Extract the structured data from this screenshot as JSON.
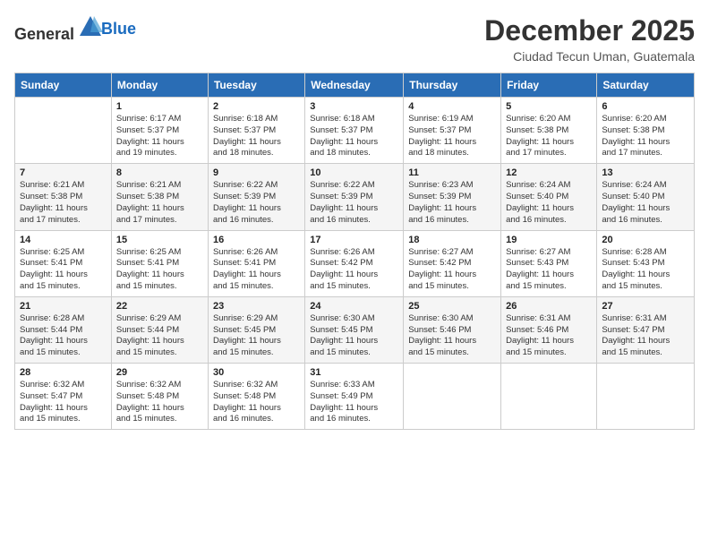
{
  "header": {
    "logo_general": "General",
    "logo_blue": "Blue",
    "title": "December 2025",
    "subtitle": "Ciudad Tecun Uman, Guatemala"
  },
  "weekdays": [
    "Sunday",
    "Monday",
    "Tuesday",
    "Wednesday",
    "Thursday",
    "Friday",
    "Saturday"
  ],
  "weeks": [
    [
      {
        "day": "",
        "info": ""
      },
      {
        "day": "1",
        "info": "Sunrise: 6:17 AM\nSunset: 5:37 PM\nDaylight: 11 hours\nand 19 minutes."
      },
      {
        "day": "2",
        "info": "Sunrise: 6:18 AM\nSunset: 5:37 PM\nDaylight: 11 hours\nand 18 minutes."
      },
      {
        "day": "3",
        "info": "Sunrise: 6:18 AM\nSunset: 5:37 PM\nDaylight: 11 hours\nand 18 minutes."
      },
      {
        "day": "4",
        "info": "Sunrise: 6:19 AM\nSunset: 5:37 PM\nDaylight: 11 hours\nand 18 minutes."
      },
      {
        "day": "5",
        "info": "Sunrise: 6:20 AM\nSunset: 5:38 PM\nDaylight: 11 hours\nand 17 minutes."
      },
      {
        "day": "6",
        "info": "Sunrise: 6:20 AM\nSunset: 5:38 PM\nDaylight: 11 hours\nand 17 minutes."
      }
    ],
    [
      {
        "day": "7",
        "info": "Sunrise: 6:21 AM\nSunset: 5:38 PM\nDaylight: 11 hours\nand 17 minutes."
      },
      {
        "day": "8",
        "info": "Sunrise: 6:21 AM\nSunset: 5:38 PM\nDaylight: 11 hours\nand 17 minutes."
      },
      {
        "day": "9",
        "info": "Sunrise: 6:22 AM\nSunset: 5:39 PM\nDaylight: 11 hours\nand 16 minutes."
      },
      {
        "day": "10",
        "info": "Sunrise: 6:22 AM\nSunset: 5:39 PM\nDaylight: 11 hours\nand 16 minutes."
      },
      {
        "day": "11",
        "info": "Sunrise: 6:23 AM\nSunset: 5:39 PM\nDaylight: 11 hours\nand 16 minutes."
      },
      {
        "day": "12",
        "info": "Sunrise: 6:24 AM\nSunset: 5:40 PM\nDaylight: 11 hours\nand 16 minutes."
      },
      {
        "day": "13",
        "info": "Sunrise: 6:24 AM\nSunset: 5:40 PM\nDaylight: 11 hours\nand 16 minutes."
      }
    ],
    [
      {
        "day": "14",
        "info": "Sunrise: 6:25 AM\nSunset: 5:41 PM\nDaylight: 11 hours\nand 15 minutes."
      },
      {
        "day": "15",
        "info": "Sunrise: 6:25 AM\nSunset: 5:41 PM\nDaylight: 11 hours\nand 15 minutes."
      },
      {
        "day": "16",
        "info": "Sunrise: 6:26 AM\nSunset: 5:41 PM\nDaylight: 11 hours\nand 15 minutes."
      },
      {
        "day": "17",
        "info": "Sunrise: 6:26 AM\nSunset: 5:42 PM\nDaylight: 11 hours\nand 15 minutes."
      },
      {
        "day": "18",
        "info": "Sunrise: 6:27 AM\nSunset: 5:42 PM\nDaylight: 11 hours\nand 15 minutes."
      },
      {
        "day": "19",
        "info": "Sunrise: 6:27 AM\nSunset: 5:43 PM\nDaylight: 11 hours\nand 15 minutes."
      },
      {
        "day": "20",
        "info": "Sunrise: 6:28 AM\nSunset: 5:43 PM\nDaylight: 11 hours\nand 15 minutes."
      }
    ],
    [
      {
        "day": "21",
        "info": "Sunrise: 6:28 AM\nSunset: 5:44 PM\nDaylight: 11 hours\nand 15 minutes."
      },
      {
        "day": "22",
        "info": "Sunrise: 6:29 AM\nSunset: 5:44 PM\nDaylight: 11 hours\nand 15 minutes."
      },
      {
        "day": "23",
        "info": "Sunrise: 6:29 AM\nSunset: 5:45 PM\nDaylight: 11 hours\nand 15 minutes."
      },
      {
        "day": "24",
        "info": "Sunrise: 6:30 AM\nSunset: 5:45 PM\nDaylight: 11 hours\nand 15 minutes."
      },
      {
        "day": "25",
        "info": "Sunrise: 6:30 AM\nSunset: 5:46 PM\nDaylight: 11 hours\nand 15 minutes."
      },
      {
        "day": "26",
        "info": "Sunrise: 6:31 AM\nSunset: 5:46 PM\nDaylight: 11 hours\nand 15 minutes."
      },
      {
        "day": "27",
        "info": "Sunrise: 6:31 AM\nSunset: 5:47 PM\nDaylight: 11 hours\nand 15 minutes."
      }
    ],
    [
      {
        "day": "28",
        "info": "Sunrise: 6:32 AM\nSunset: 5:47 PM\nDaylight: 11 hours\nand 15 minutes."
      },
      {
        "day": "29",
        "info": "Sunrise: 6:32 AM\nSunset: 5:48 PM\nDaylight: 11 hours\nand 15 minutes."
      },
      {
        "day": "30",
        "info": "Sunrise: 6:32 AM\nSunset: 5:48 PM\nDaylight: 11 hours\nand 16 minutes."
      },
      {
        "day": "31",
        "info": "Sunrise: 6:33 AM\nSunset: 5:49 PM\nDaylight: 11 hours\nand 16 minutes."
      },
      {
        "day": "",
        "info": ""
      },
      {
        "day": "",
        "info": ""
      },
      {
        "day": "",
        "info": ""
      }
    ]
  ]
}
